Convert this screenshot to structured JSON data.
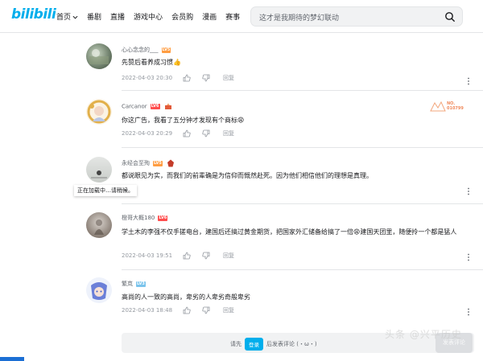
{
  "header": {
    "logo": "bilibili",
    "nav": [
      "首页",
      "番剧",
      "直播",
      "游戏中心",
      "会员购",
      "漫画",
      "赛事"
    ],
    "search_placeholder": "这才是我期待的梦幻联动"
  },
  "comments": [
    {
      "user": "心心念念的___",
      "level": "LV5",
      "level_color": "#ff9d42",
      "text": "先赞后看养成习惯👍",
      "time": "2022-04-03 20:30",
      "reply": "回复"
    },
    {
      "user": "Carcanor",
      "level": "LV6",
      "level_color": "#ff4d4d",
      "text": "你这广告，我看了五分钟才发现有个商标😩",
      "time": "2022-04-03 20:29",
      "reply": "回复",
      "badge": "NO. 010799"
    },
    {
      "user": "永经会至殉",
      "level": "LV5",
      "level_color": "#ff9d42",
      "text": "都说眼见为实，而我们的前辈确是为信仰而慨然赴死。因为他们相信他们的理想是真理。",
      "time": "",
      "reply": ""
    },
    {
      "user": "橙哥大概180",
      "level": "LV6",
      "level_color": "#ff4d4d",
      "text": "学土木的李强不仅手搓电台，建国后还搞过黄金期货，把国家外汇储备给搞了一倍😩建国天团里，随便拎一个都是猛人",
      "time": "2022-04-03 19:51",
      "reply": "回复"
    },
    {
      "user": "繁岚",
      "level": "LV3",
      "level_color": "#7bc4ec",
      "text": "高尚的人一致的高尚，卑劣的人卑劣奇般卑劣",
      "time": "2022-04-03 18:48",
      "reply": "回复"
    }
  ],
  "tooltip": "正在加载中…请稍候。",
  "reply_box": {
    "prefix": "请先",
    "login": "登录",
    "suffix": "后发表评论 (・ω・)",
    "send": "发表评论"
  },
  "watermark": "头条 @兴平历史"
}
